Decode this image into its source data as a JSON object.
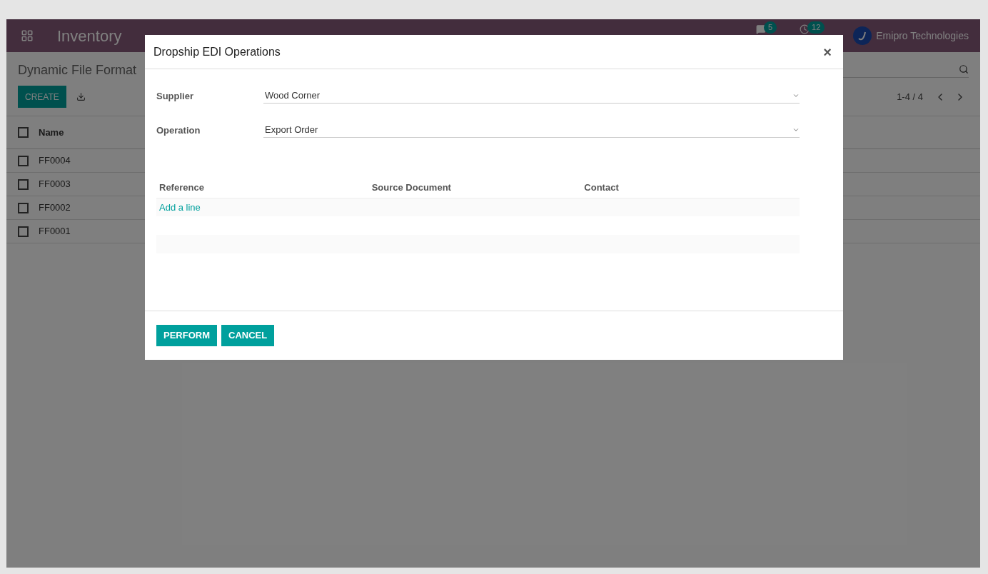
{
  "navbar": {
    "app_title": "Inventory",
    "messages_count": "5",
    "activities_count": "12",
    "company": "Emipro Technologies"
  },
  "control_panel": {
    "title": "Dynamic File Format",
    "create_button": "CREATE",
    "pager": "1-4 / 4"
  },
  "list": {
    "columns": [
      "Name"
    ],
    "header_checked": false,
    "rows": [
      {
        "name": "FF0004",
        "checked": false
      },
      {
        "name": "FF0003",
        "checked": false
      },
      {
        "name": "FF0002",
        "checked": false
      },
      {
        "name": "FF0001",
        "checked": false
      }
    ]
  },
  "dialog": {
    "title": "Dropship EDI Operations",
    "close": "×",
    "fields": [
      {
        "label": "Supplier",
        "value": "Wood Corner"
      },
      {
        "label": "Operation",
        "value": "Export Order"
      }
    ],
    "table": {
      "columns": [
        "Reference",
        "Source Document",
        "Contact"
      ],
      "add_line": "Add a line"
    },
    "buttons": [
      "PERFORM",
      "CANCEL"
    ]
  }
}
